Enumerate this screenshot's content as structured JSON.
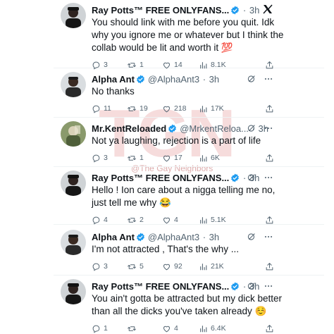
{
  "watermark": {
    "logo_text": "TGN",
    "caption": "@The Gay Neighbors"
  },
  "tweets": [
    {
      "name": "Ray Potts™ FREE ONLYFANS...",
      "handle": "",
      "time": "3h",
      "avatar": "avatar-ray",
      "lines": [
        "You should link with me before you quit. Idk",
        "why you ignore me or whatever but I think the",
        "collab would be lit and worth it 💯"
      ],
      "stats": {
        "replies": "3",
        "reposts": "1",
        "likes": "14",
        "views": "8.1K"
      }
    },
    {
      "name": "Alpha Ant",
      "handle": "@AlphaAnt3",
      "time": "3h",
      "avatar": "avatar-alpha",
      "lines": [
        "No thanks"
      ],
      "stats": {
        "replies": "11",
        "reposts": "19",
        "likes": "218",
        "views": "17K"
      }
    },
    {
      "name": "Mr.KentReloaded",
      "handle": "@MrkentReloa...",
      "time": "3h",
      "avatar": "avatar-kent",
      "lines": [
        "Not ya laughing,  rejection is a part of life"
      ],
      "stats": {
        "replies": "3",
        "reposts": "1",
        "likes": "17",
        "views": "6K"
      }
    },
    {
      "name": "Ray Potts™ FREE ONLYFANS...",
      "handle": "",
      "time": "3h",
      "avatar": "avatar-ray",
      "lines": [
        "Hello ! Ion care about a nigga telling me no,",
        "just tell me why 😂"
      ],
      "stats": {
        "replies": "4",
        "reposts": "2",
        "likes": "4",
        "views": "5.1K"
      }
    },
    {
      "name": "Alpha Ant",
      "handle": "@AlphaAnt3",
      "time": "3h",
      "avatar": "avatar-alpha",
      "lines": [
        "I'm not attracted , That's the why ..."
      ],
      "stats": {
        "replies": "3",
        "reposts": "5",
        "likes": "92",
        "views": "21K"
      }
    },
    {
      "name": "Ray Potts™ FREE ONLYFANS...",
      "handle": "",
      "time": "3h",
      "avatar": "avatar-ray",
      "lines": [
        "You ain't gotta be attracted but my dick better",
        "than all the dicks you've taken already ☺️"
      ],
      "stats": {
        "replies": "1",
        "reposts": "",
        "likes": "4",
        "views": "6.4K"
      }
    }
  ],
  "colors": {
    "verified": "#1d9bf0",
    "text": "#0f1419",
    "muted": "#536471",
    "watermark": "#c82828"
  },
  "icons": [
    "verified-badge-icon",
    "x-logo-icon",
    "grok-icon",
    "more-icon",
    "reply-icon",
    "repost-icon",
    "like-icon",
    "views-icon",
    "share-icon"
  ]
}
